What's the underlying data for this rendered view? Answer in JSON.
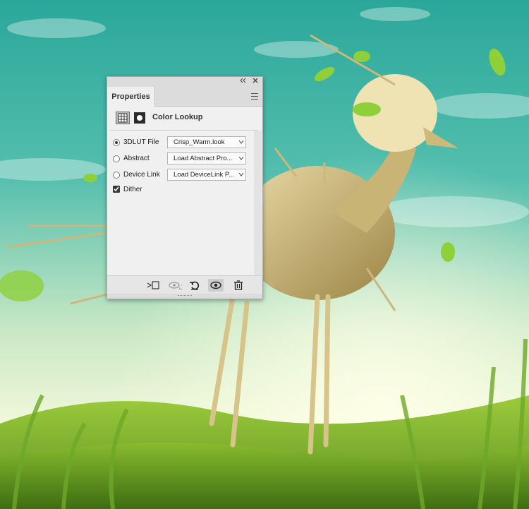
{
  "panel": {
    "tab_label": "Properties",
    "header_title": "Color Lookup",
    "rows": [
      {
        "label": "3DLUT File",
        "value": "Crisp_Warm.look",
        "selected": true
      },
      {
        "label": "Abstract",
        "value": "Load Abstract Pro...",
        "selected": false
      },
      {
        "label": "Device Link",
        "value": "Load DeviceLink P...",
        "selected": false
      }
    ],
    "dither": {
      "label": "Dither",
      "checked": true
    }
  },
  "icons": {
    "collapse": "double-chevron-left-icon",
    "close": "close-icon",
    "menu": "hamburger-menu-icon",
    "adjustment": "grid-adjustment-icon",
    "mask": "layer-mask-icon",
    "clip": "clip-to-layer-icon",
    "view_previous": "view-previous-state-icon",
    "reset": "reset-icon",
    "visibility": "eye-icon",
    "delete": "trash-icon"
  },
  "colors": {
    "panel_bg": "#f0f0f0",
    "sky_top": "#2fae9f",
    "grass": "#7fb732"
  }
}
